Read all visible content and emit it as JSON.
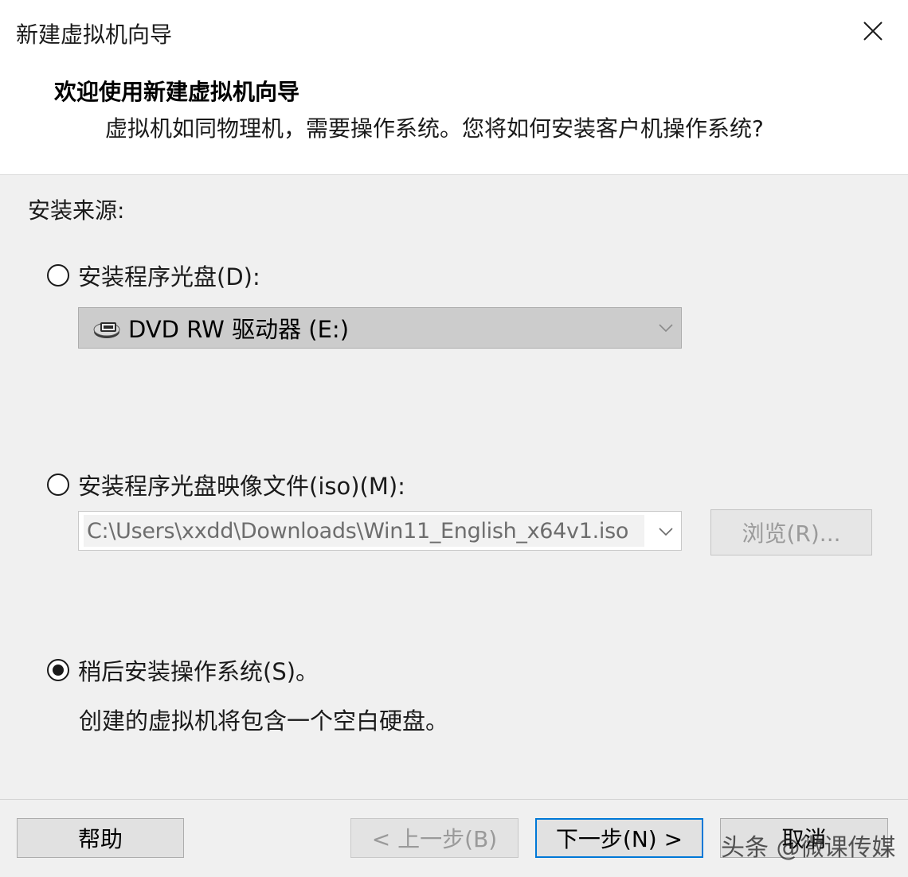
{
  "window": {
    "title": "新建虚拟机向导",
    "close_icon": "close-icon"
  },
  "wizard": {
    "heading": "欢迎使用新建虚拟机向导",
    "description": "虚拟机如同物理机，需要操作系统。您将如何安装客户机操作系统?"
  },
  "install_source": {
    "label": "安装来源:",
    "option_disc": {
      "label": "安装程序光盘(D):",
      "selected": false,
      "drive_value": "DVD RW 驱动器 (E:)",
      "drive_icon": "dvd-drive-icon"
    },
    "option_iso": {
      "label": "安装程序光盘映像文件(iso)(M):",
      "selected": false,
      "path_value": "C:\\Users\\xxdd\\Downloads\\Win11_English_x64v1.iso",
      "browse_label": "浏览(R)..."
    },
    "option_later": {
      "label": "稍后安装操作系统(S)。",
      "selected": true,
      "description": "创建的虚拟机将包含一个空白硬盘。"
    }
  },
  "footer": {
    "help_label": "帮助",
    "back_label": "< 上一步(B)",
    "next_label": "下一步(N) >",
    "cancel_label": "取消"
  },
  "watermark": "头条 @微课传媒",
  "colors": {
    "accent": "#0078d7",
    "background": "#f0f0f0",
    "header_background": "#ffffff",
    "disabled_text": "#9a9a9a"
  }
}
